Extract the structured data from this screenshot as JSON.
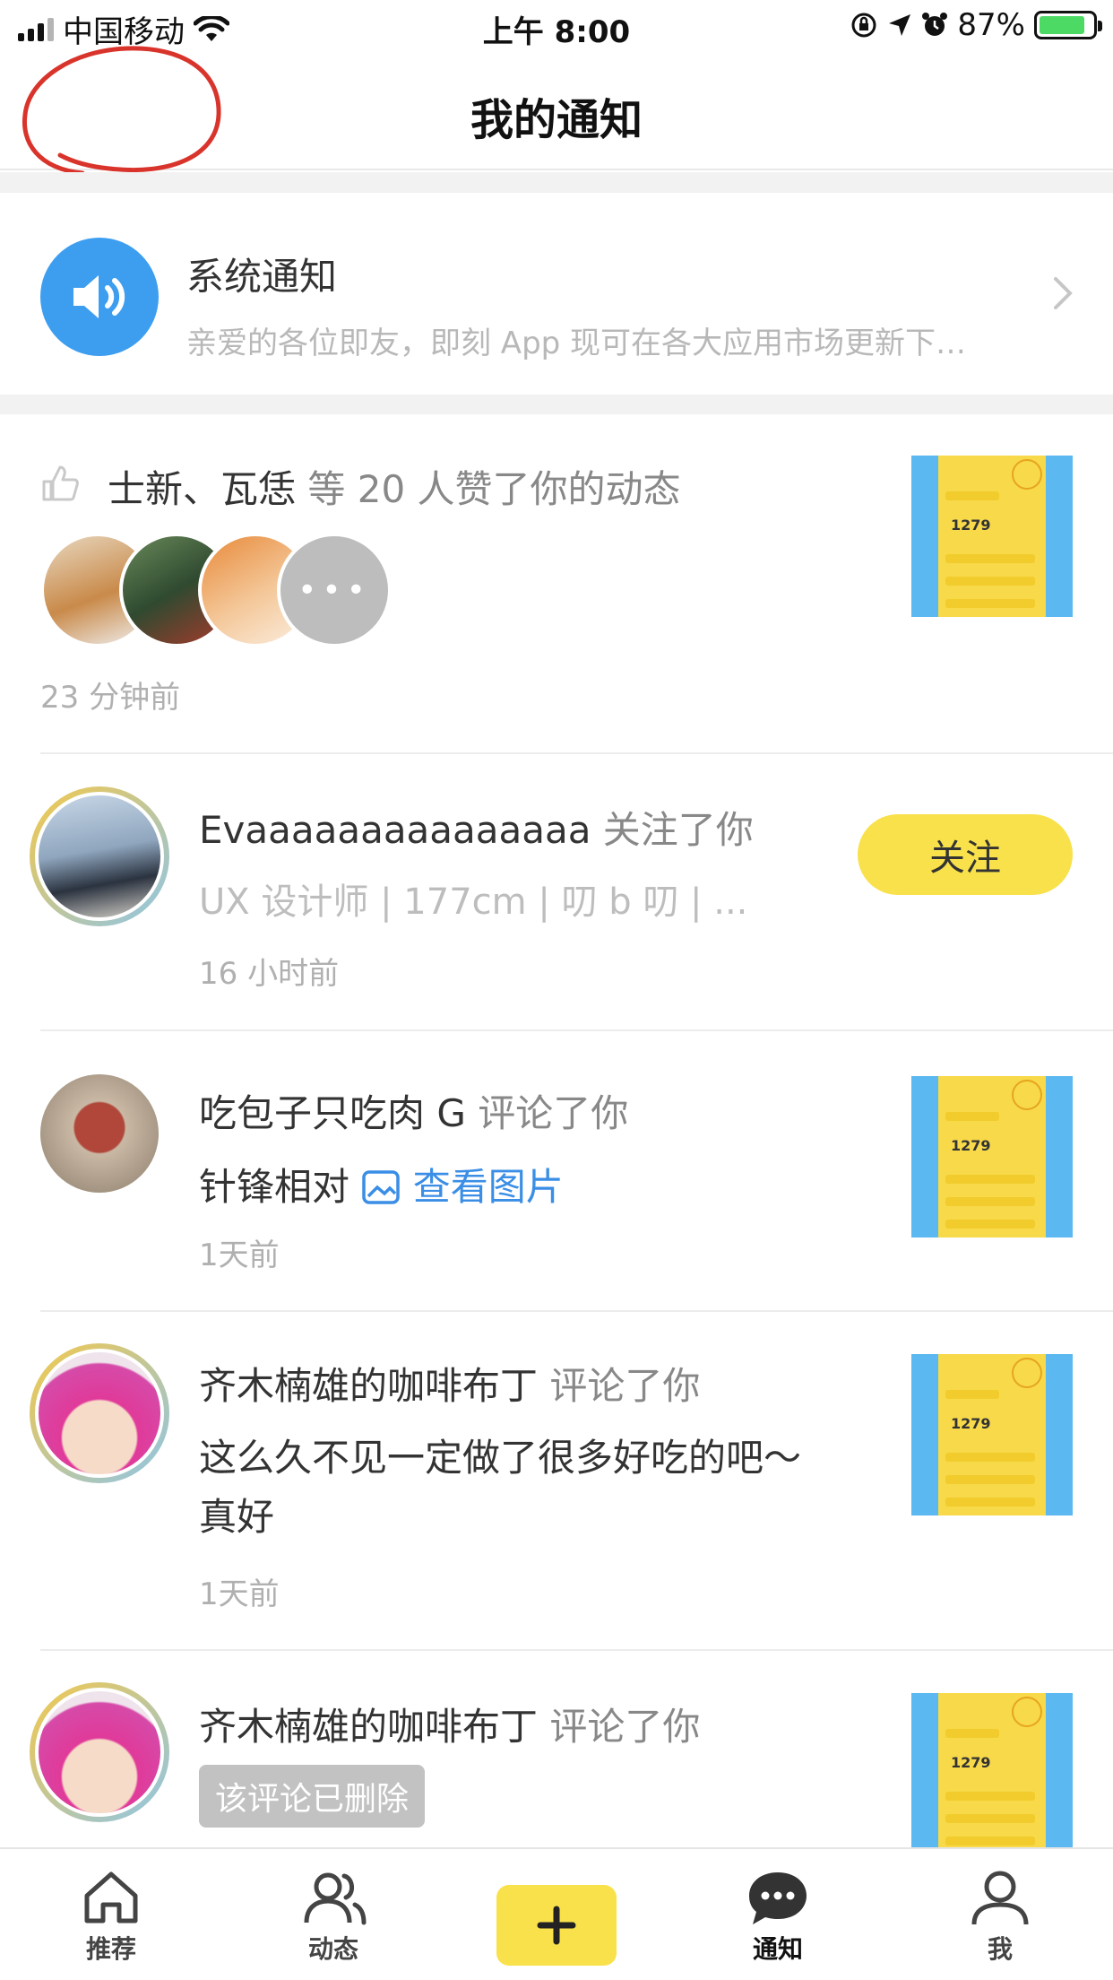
{
  "status_bar": {
    "carrier": "中国移动",
    "time": "上午 8:00",
    "battery": "87%",
    "battery_level": 0.87
  },
  "header": {
    "title": "我的通知"
  },
  "system_notice": {
    "icon": "speaker-icon",
    "title": "系统通知",
    "subtitle": "亲爱的各位即友，即刻 App 现可在各大应用市场更新下…"
  },
  "notifications": [
    {
      "type": "like",
      "names": "士新、瓦恁",
      "action": " 等 20 人赞了你的动态",
      "time": "23 分钟前",
      "more": "•••"
    },
    {
      "type": "follow",
      "name": "Evaaaaaaaaaaaaaaa",
      "action": " 关注了你",
      "bio": "UX 设计师 | 177cm | 叨 b 叨 | ...",
      "time": "16 小时前",
      "button": "关注"
    },
    {
      "type": "comment",
      "name": "吃包子只吃肉 G",
      "action": " 评论了你",
      "content": "针锋相对 ",
      "link": "查看图片",
      "time": "1天前"
    },
    {
      "type": "comment",
      "name": "齐木楠雄的咖啡布丁",
      "action": " 评论了你",
      "content_line1": "这么久不见一定做了很多好吃的吧～",
      "content_line2": "真好",
      "time": "1天前"
    },
    {
      "type": "comment",
      "name": "齐木楠雄的咖啡布丁",
      "action": " 评论了你",
      "deleted": "该评论已删除"
    }
  ],
  "thumb": {
    "number": "1279"
  },
  "tabbar": {
    "items": [
      {
        "label": "推荐",
        "icon": "home-icon"
      },
      {
        "label": "动态",
        "icon": "people-icon"
      },
      {
        "label": "",
        "icon": "plus-icon"
      },
      {
        "label": "通知",
        "icon": "chat-bubble-icon"
      },
      {
        "label": "我",
        "icon": "person-icon"
      }
    ]
  },
  "colors": {
    "accent_yellow": "#f9e14b",
    "link_blue": "#3a8ee6",
    "system_blue": "#3d9ef0",
    "annotation_red": "#d9342b"
  }
}
